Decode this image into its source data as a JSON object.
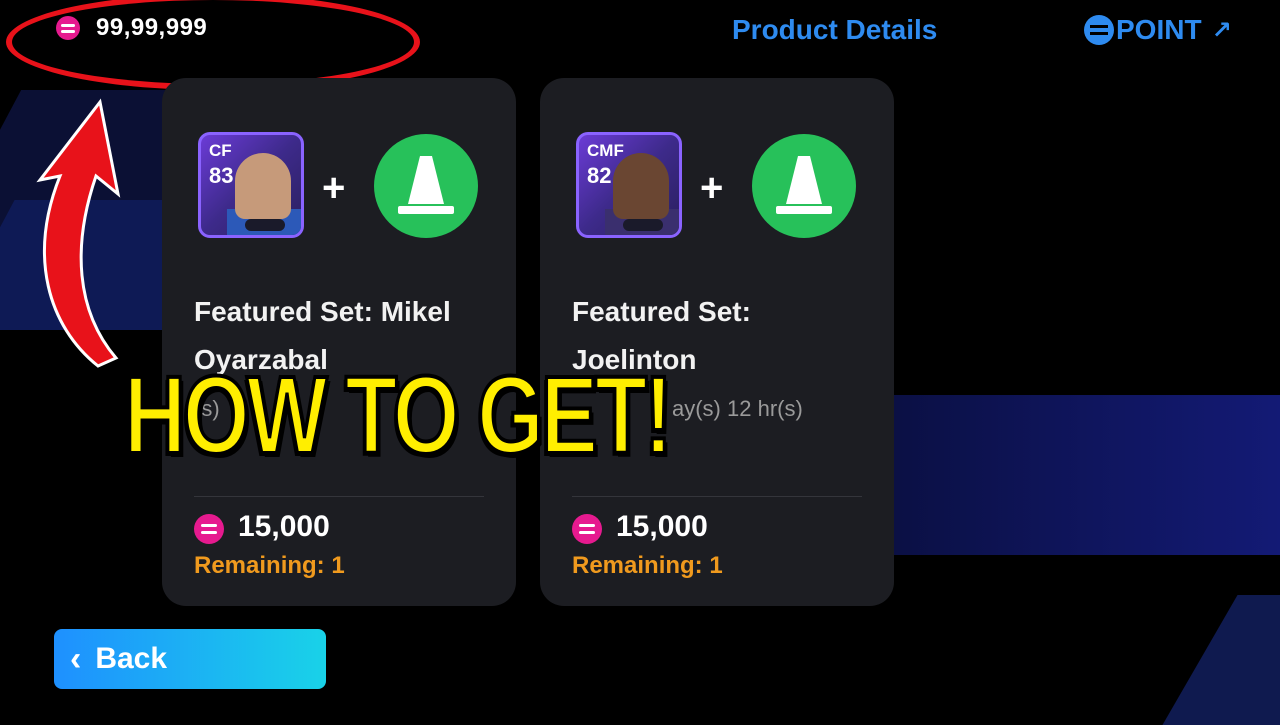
{
  "header": {
    "balance": "99,99,999",
    "product_details": "Product Details",
    "point_label": "POINT",
    "point_arrow": "↗"
  },
  "cards": [
    {
      "position": "CF",
      "rating": "83",
      "title": "Featured Set: Mikel Oyarzabal",
      "timer": "(s)",
      "price": "15,000",
      "remaining": "Remaining: 1"
    },
    {
      "position": "CMF",
      "rating": "82",
      "title": "Featured Set: Joelinton",
      "timer": "ay(s) 12 hr(s)",
      "price": "15,000",
      "remaining": "Remaining: 1"
    }
  ],
  "overlay": {
    "headline": "HOW TO GET!"
  },
  "footer": {
    "back_label": "Back",
    "back_icon": "chevron-left-icon"
  },
  "colors": {
    "coin": "#e61a8f",
    "link_blue": "#2e8bf0",
    "remaining_orange": "#f09a1e",
    "cone_green": "#27c15a",
    "headline_yellow": "#ffee00",
    "highlight_red": "#e8121a"
  }
}
